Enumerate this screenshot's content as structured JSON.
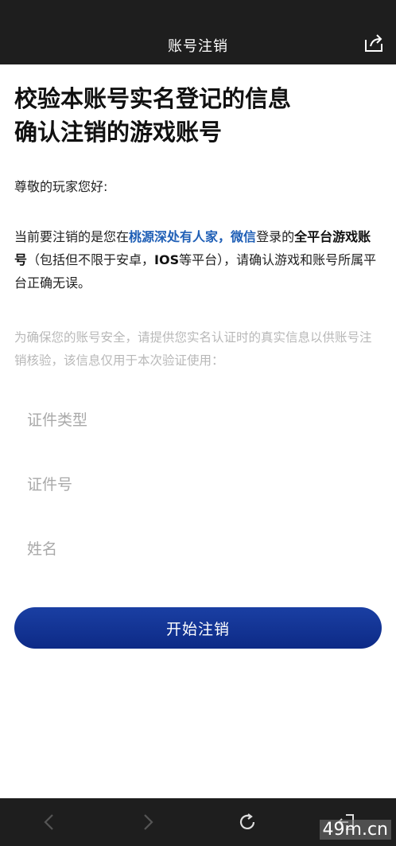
{
  "header": {
    "title": "账号注销"
  },
  "main": {
    "headline_line1": "校验本账号实名登记的信息",
    "headline_line2": "确认注销的游戏账号",
    "greeting": "尊敬的玩家您好:",
    "intro": {
      "part1": "当前要注销的是您在",
      "game_name": "桃源深处有人家",
      "comma": "，",
      "platform": "微信",
      "part2": "登录的",
      "bold_text": "全平台游戏账号",
      "part3": "（包括但不限于安卓，",
      "ios_text": "IOS",
      "part4": "等平台），请确认游戏和账号所属平台正确无误。"
    },
    "notice": "为确保您的账号安全，请提供您实名认证时的真实信息以供账号注销核验，该信息仅用于本次验证使用："
  },
  "form": {
    "id_type_placeholder": "证件类型",
    "id_number_placeholder": "证件号",
    "name_placeholder": "姓名",
    "submit_label": "开始注销"
  },
  "watermark": "49m.cn",
  "icons": [
    "share-icon",
    "back-arrow-icon",
    "forward-arrow-icon",
    "refresh-icon",
    "exit-icon"
  ]
}
